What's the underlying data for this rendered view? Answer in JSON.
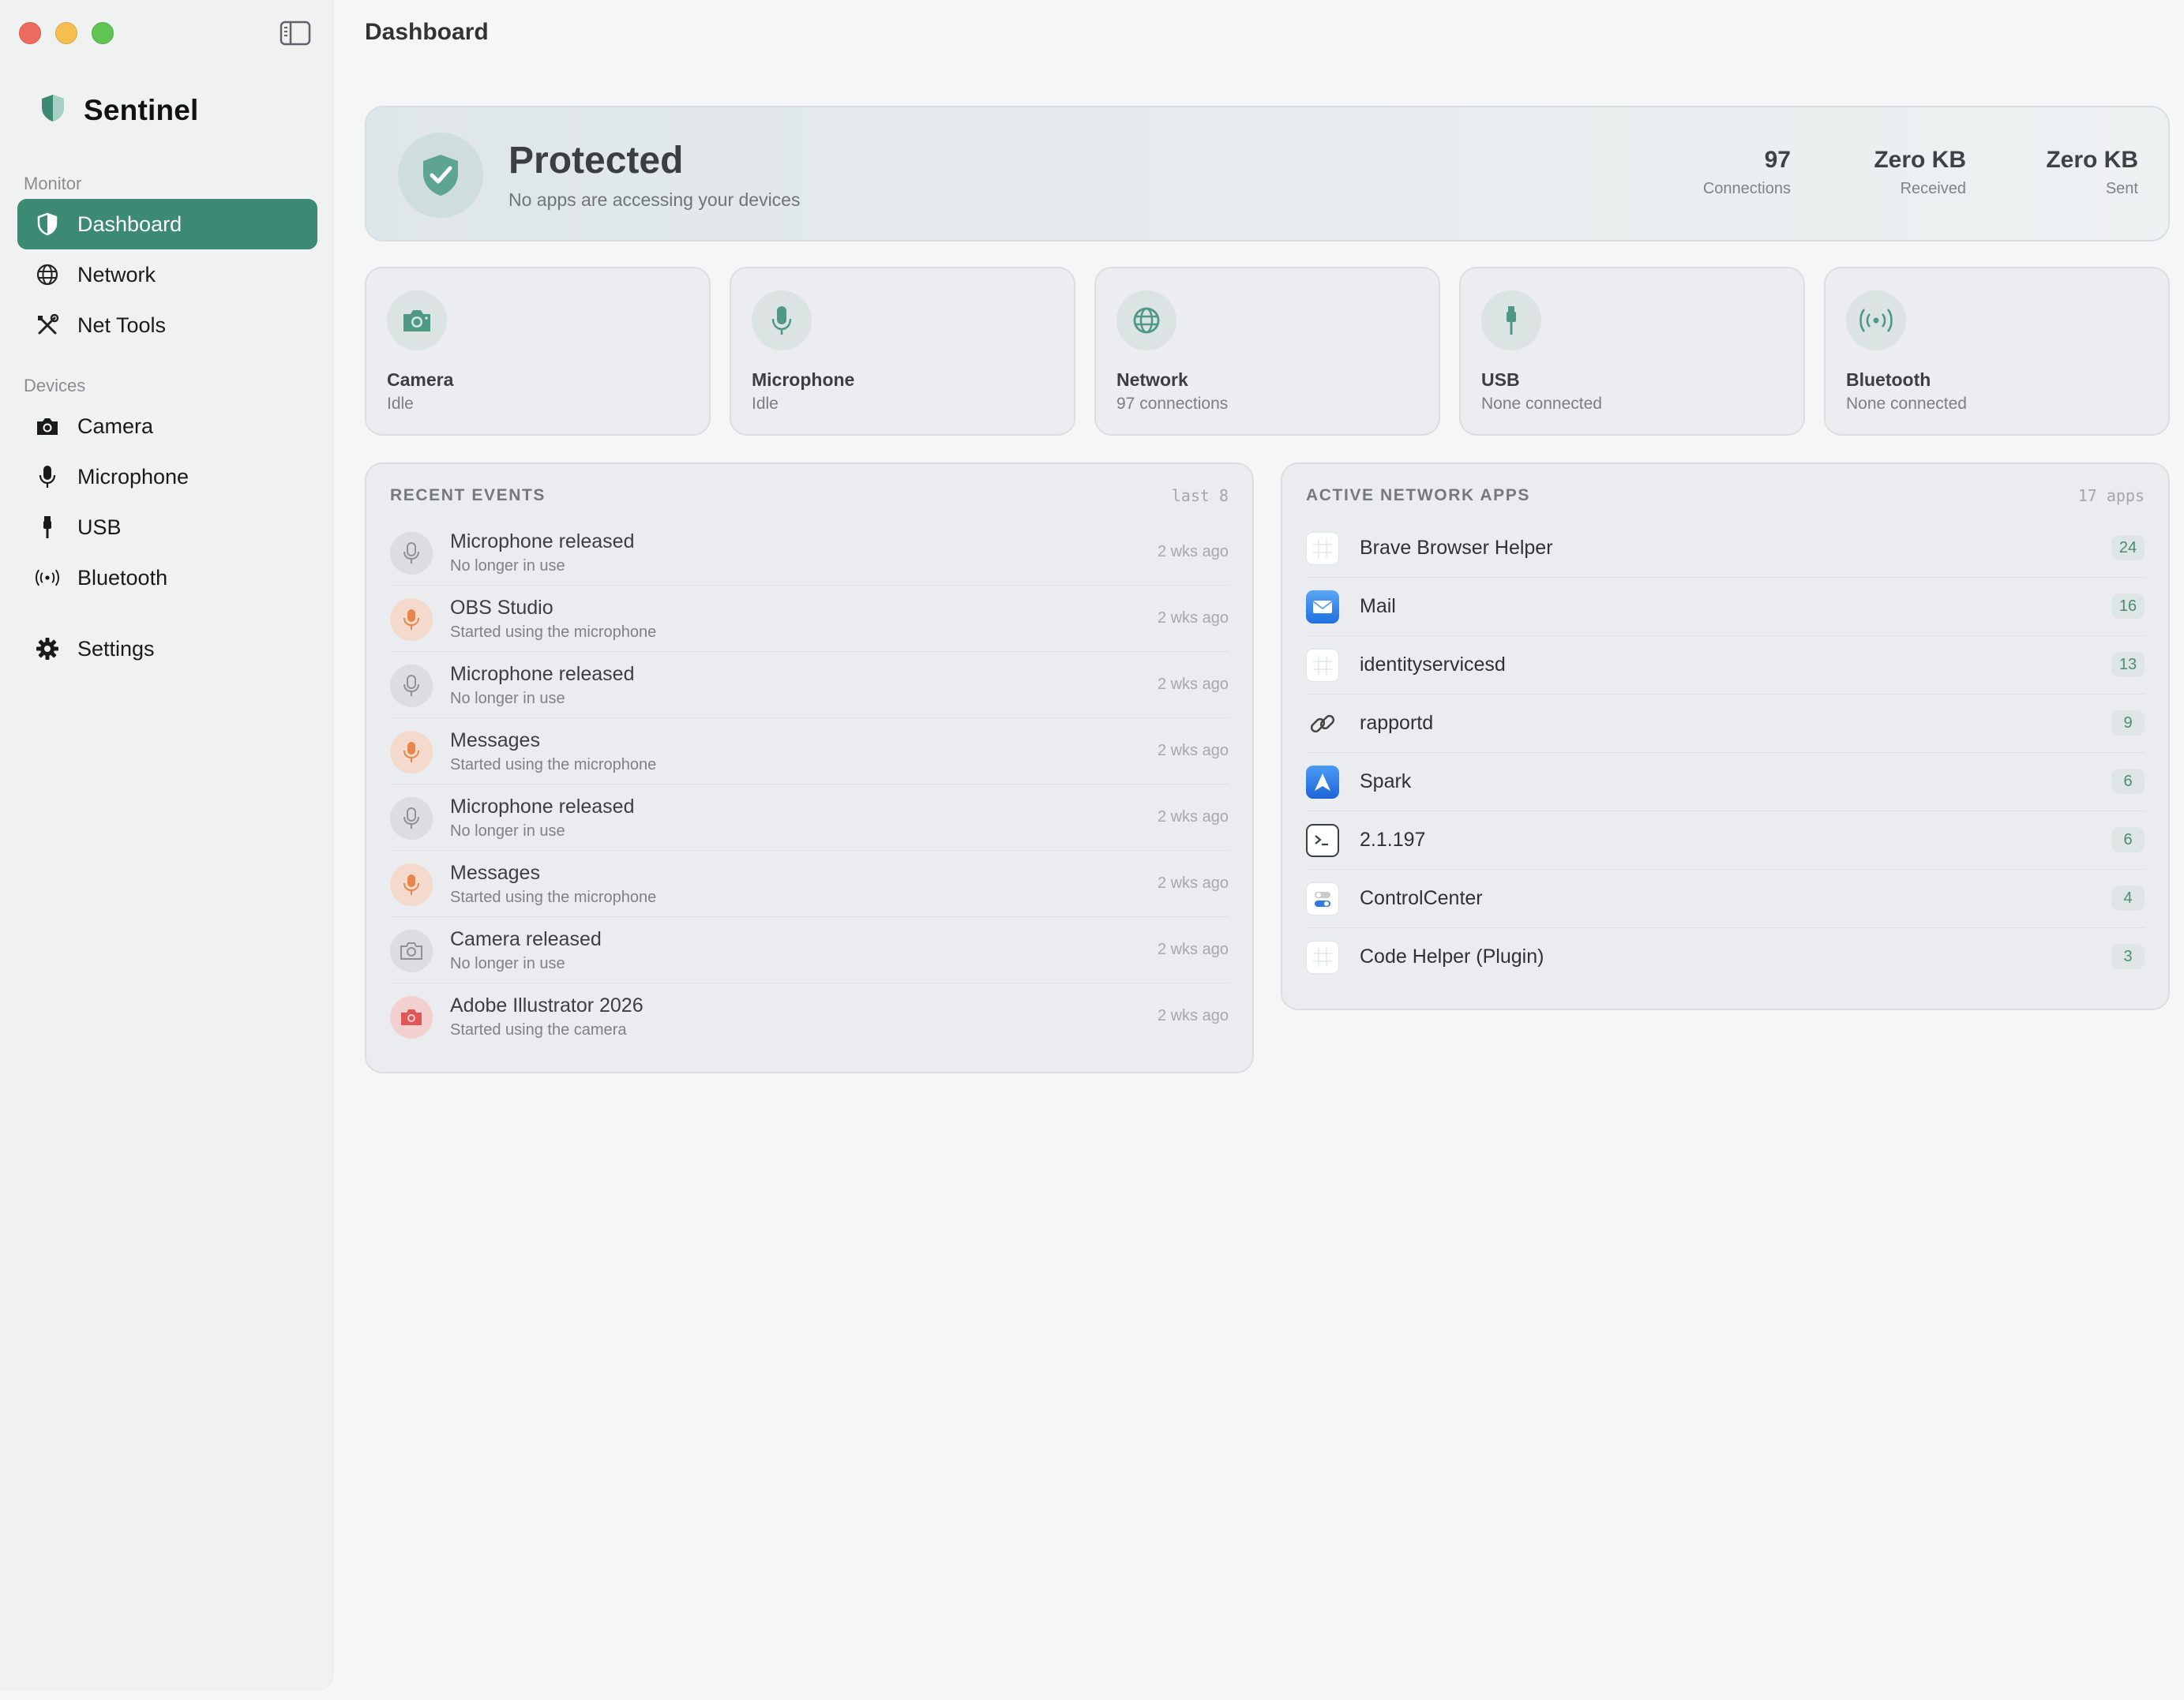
{
  "window": {
    "title": "Dashboard"
  },
  "sidebar": {
    "brand": "Sentinel",
    "sections": {
      "monitor": "Monitor",
      "devices": "Devices"
    },
    "items": [
      {
        "label": "Dashboard",
        "icon": "shield-icon"
      },
      {
        "label": "Network",
        "icon": "globe-icon"
      },
      {
        "label": "Net Tools",
        "icon": "tools-icon"
      },
      {
        "label": "Camera",
        "icon": "camera-icon"
      },
      {
        "label": "Microphone",
        "icon": "microphone-icon"
      },
      {
        "label": "USB",
        "icon": "usb-icon"
      },
      {
        "label": "Bluetooth",
        "icon": "bluetooth-icon"
      },
      {
        "label": "Settings",
        "icon": "gear-icon"
      }
    ]
  },
  "status": {
    "title": "Protected",
    "subtitle": "No apps are accessing your devices",
    "stats": [
      {
        "value": "97",
        "label": "Connections"
      },
      {
        "value": "Zero KB",
        "label": "Received"
      },
      {
        "value": "Zero KB",
        "label": "Sent"
      }
    ]
  },
  "devices": [
    {
      "name": "Camera",
      "status": "Idle",
      "icon": "camera-icon"
    },
    {
      "name": "Microphone",
      "status": "Idle",
      "icon": "microphone-icon"
    },
    {
      "name": "Network",
      "status": "97 connections",
      "icon": "globe-icon"
    },
    {
      "name": "USB",
      "status": "None connected",
      "icon": "usb-icon"
    },
    {
      "name": "Bluetooth",
      "status": "None connected",
      "icon": "bluetooth-icon"
    }
  ],
  "recent_events": {
    "title": "RECENT EVENTS",
    "count": "last 8",
    "items": [
      {
        "title": "Microphone released",
        "subtitle": "No longer in use",
        "time": "2 wks ago",
        "kind": "mic-released"
      },
      {
        "title": "OBS Studio",
        "subtitle": "Started using the microphone",
        "time": "2 wks ago",
        "kind": "mic-active"
      },
      {
        "title": "Microphone released",
        "subtitle": "No longer in use",
        "time": "2 wks ago",
        "kind": "mic-released"
      },
      {
        "title": "Messages",
        "subtitle": "Started using the microphone",
        "time": "2 wks ago",
        "kind": "mic-active"
      },
      {
        "title": "Microphone released",
        "subtitle": "No longer in use",
        "time": "2 wks ago",
        "kind": "mic-released"
      },
      {
        "title": "Messages",
        "subtitle": "Started using the microphone",
        "time": "2 wks ago",
        "kind": "mic-active"
      },
      {
        "title": "Camera released",
        "subtitle": "No longer in use",
        "time": "2 wks ago",
        "kind": "cam-released"
      },
      {
        "title": "Adobe Illustrator 2026",
        "subtitle": "Started using the camera",
        "time": "2 wks ago",
        "kind": "cam-active"
      }
    ]
  },
  "active_apps": {
    "title": "ACTIVE NETWORK APPS",
    "count": "17 apps",
    "items": [
      {
        "name": "Brave Browser Helper",
        "count": "24",
        "icon": "generic-app-icon"
      },
      {
        "name": "Mail",
        "count": "16",
        "icon": "mail-icon"
      },
      {
        "name": "identityservicesd",
        "count": "13",
        "icon": "generic-app-icon"
      },
      {
        "name": "rapportd",
        "count": "9",
        "icon": "link-icon"
      },
      {
        "name": "Spark",
        "count": "6",
        "icon": "spark-icon"
      },
      {
        "name": "2.1.197",
        "count": "6",
        "icon": "terminal-icon"
      },
      {
        "name": "ControlCenter",
        "count": "4",
        "icon": "toggle-icon"
      },
      {
        "name": "Code Helper (Plugin)",
        "count": "3",
        "icon": "generic-app-icon"
      }
    ]
  },
  "colors": {
    "accent": "#3d8a74",
    "accent_soft": "#4c8b77",
    "mic_active": "#e8874b",
    "cam_active": "#e05555",
    "released": "#8e9296"
  }
}
